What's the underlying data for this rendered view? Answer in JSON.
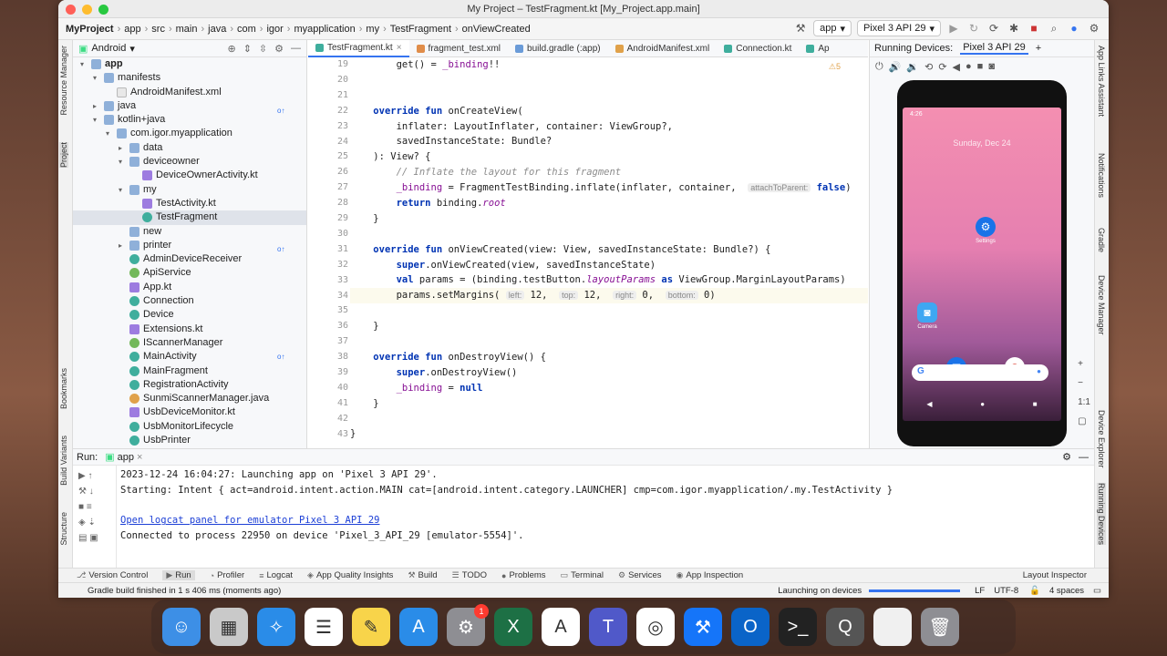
{
  "window": {
    "title": "My Project – TestFragment.kt [My_Project.app.main]"
  },
  "breadcrumb": [
    "MyProject",
    "app",
    "src",
    "main",
    "java",
    "com",
    "igor",
    "myapplication",
    "my",
    "TestFragment",
    "onViewCreated"
  ],
  "toolbar": {
    "run_config": "app",
    "device": "Pixel 3 API 29"
  },
  "left_stripe": [
    "Resource Manager",
    "Project",
    "Bookmarks",
    "Build Variants",
    "Structure"
  ],
  "right_stripe": [
    "App Links Assistant",
    "Notifications",
    "Gradle",
    "Device Manager",
    "Device Explorer",
    "Running Devices"
  ],
  "project": {
    "view": "Android",
    "tree": [
      {
        "label": "app",
        "indent": 0,
        "arrow": "▾",
        "icon": "folder",
        "bold": true
      },
      {
        "label": "manifests",
        "indent": 1,
        "arrow": "▾",
        "icon": "folder"
      },
      {
        "label": "AndroidManifest.xml",
        "indent": 2,
        "arrow": "",
        "icon": "file"
      },
      {
        "label": "java",
        "indent": 1,
        "arrow": "▸",
        "icon": "folder"
      },
      {
        "label": "kotlin+java",
        "indent": 1,
        "arrow": "▾",
        "icon": "folder"
      },
      {
        "label": "com.igor.myapplication",
        "indent": 2,
        "arrow": "▾",
        "icon": "folder"
      },
      {
        "label": "data",
        "indent": 3,
        "arrow": "▸",
        "icon": "folder"
      },
      {
        "label": "deviceowner",
        "indent": 3,
        "arrow": "▾",
        "icon": "folder"
      },
      {
        "label": "DeviceOwnerActivity.kt",
        "indent": 4,
        "arrow": "",
        "icon": "kt"
      },
      {
        "label": "my",
        "indent": 3,
        "arrow": "▾",
        "icon": "folder"
      },
      {
        "label": "TestActivity.kt",
        "indent": 4,
        "arrow": "",
        "icon": "kt"
      },
      {
        "label": "TestFragment",
        "indent": 4,
        "arrow": "",
        "icon": "cls",
        "selected": true
      },
      {
        "label": "new",
        "indent": 3,
        "arrow": "",
        "icon": "folder"
      },
      {
        "label": "printer",
        "indent": 3,
        "arrow": "▸",
        "icon": "folder"
      },
      {
        "label": "AdminDeviceReceiver",
        "indent": 3,
        "arrow": "",
        "icon": "cls"
      },
      {
        "label": "ApiService",
        "indent": 3,
        "arrow": "",
        "icon": "iface"
      },
      {
        "label": "App.kt",
        "indent": 3,
        "arrow": "",
        "icon": "kt"
      },
      {
        "label": "Connection",
        "indent": 3,
        "arrow": "",
        "icon": "cls"
      },
      {
        "label": "Device",
        "indent": 3,
        "arrow": "",
        "icon": "cls"
      },
      {
        "label": "Extensions.kt",
        "indent": 3,
        "arrow": "",
        "icon": "kt"
      },
      {
        "label": "IScannerManager",
        "indent": 3,
        "arrow": "",
        "icon": "iface"
      },
      {
        "label": "MainActivity",
        "indent": 3,
        "arrow": "",
        "icon": "cls"
      },
      {
        "label": "MainFragment",
        "indent": 3,
        "arrow": "",
        "icon": "cls"
      },
      {
        "label": "RegistrationActivity",
        "indent": 3,
        "arrow": "",
        "icon": "cls"
      },
      {
        "label": "SunmiScannerManager.java",
        "indent": 3,
        "arrow": "",
        "icon": "java"
      },
      {
        "label": "UsbDeviceMonitor.kt",
        "indent": 3,
        "arrow": "",
        "icon": "kt"
      },
      {
        "label": "UsbMonitorLifecycle",
        "indent": 3,
        "arrow": "",
        "icon": "cls"
      },
      {
        "label": "UsbPrinter",
        "indent": 3,
        "arrow": "",
        "icon": "cls"
      }
    ]
  },
  "editor": {
    "tabs": [
      {
        "label": "TestFragment.kt",
        "color": "#3fae9d",
        "active": true
      },
      {
        "label": "fragment_test.xml",
        "color": "#e08d4a"
      },
      {
        "label": "build.gradle (:app)",
        "color": "#6a9bd8"
      },
      {
        "label": "AndroidManifest.xml",
        "color": "#e0a14a"
      },
      {
        "label": "Connection.kt",
        "color": "#3fae9d"
      },
      {
        "label": "Ap",
        "color": "#3fae9d"
      }
    ],
    "warning": "⚠5",
    "lines": [
      {
        "n": "19",
        "html": "        get() = <span class='prop'>_binding</span>!!"
      },
      {
        "n": "20",
        "html": ""
      },
      {
        "n": "21",
        "html": ""
      },
      {
        "n": "22",
        "html": "    <span class='kw'>override fun</span> onCreateView(",
        "mark": "o"
      },
      {
        "n": "23",
        "html": "        inflater: LayoutInflater, container: ViewGroup?,"
      },
      {
        "n": "24",
        "html": "        savedInstanceState: Bundle?"
      },
      {
        "n": "25",
        "html": "    ): View? {"
      },
      {
        "n": "26",
        "html": "        <span class='cm'>// Inflate the layout for this fragment</span>"
      },
      {
        "n": "27",
        "html": "        <span class='prop'>_binding</span> = FragmentTestBinding.inflate(inflater, container,  <span class='hint'>attachToParent:</span> <span class='kw'>false</span>)"
      },
      {
        "n": "28",
        "html": "        <span class='kw'>return</span> binding.<span class='prop ital'>root</span>"
      },
      {
        "n": "29",
        "html": "    }"
      },
      {
        "n": "30",
        "html": ""
      },
      {
        "n": "31",
        "html": "    <span class='kw'>override fun</span> onViewCreated(view: View, savedInstanceState: Bundle?) {",
        "mark": "o"
      },
      {
        "n": "32",
        "html": "        <span class='kw'>super</span>.onViewCreated(view, savedInstanceState)"
      },
      {
        "n": "33",
        "html": "        <span class='kw'>val</span> params = (binding.testButton.<span class='prop ital'>layoutParams</span> <span class='kw'>as</span> ViewGroup.MarginLayoutParams)"
      },
      {
        "n": "34",
        "html": "        params.setMargins( <span class='hint'>left:</span> 12,  <span class='hint'>top:</span> 12,  <span class='hint'>right:</span> 0,  <span class='hint'>bottom:</span> 0)",
        "current": true
      },
      {
        "n": "35",
        "html": ""
      },
      {
        "n": "36",
        "html": "    }"
      },
      {
        "n": "37",
        "html": ""
      },
      {
        "n": "38",
        "html": "    <span class='kw'>override fun</span> onDestroyView() {",
        "mark": "o"
      },
      {
        "n": "39",
        "html": "        <span class='kw'>super</span>.onDestroyView()"
      },
      {
        "n": "40",
        "html": "        <span class='prop'>_binding</span> = <span class='kw'>null</span>"
      },
      {
        "n": "41",
        "html": "    }"
      },
      {
        "n": "42",
        "html": ""
      },
      {
        "n": "43",
        "html": "}"
      }
    ]
  },
  "devices": {
    "header": "Running Devices:",
    "tab": "Pixel 3 API 29",
    "date": "Sunday, Dec 24",
    "icon_labels": [
      "Settings",
      "Camera"
    ],
    "clock": "4:26"
  },
  "run": {
    "label": "Run:",
    "tab": "app",
    "output": [
      {
        "text": "2023-12-24 16:04:27: Launching app on 'Pixel 3 API 29'."
      },
      {
        "text": "Starting: Intent { act=android.intent.action.MAIN cat=[android.intent.category.LAUNCHER] cmp=com.igor.myapplication/.my.TestActivity }"
      },
      {
        "text": ""
      },
      {
        "text": "Open logcat panel for emulator Pixel 3 API 29",
        "link": true
      },
      {
        "text": "Connected to process 22950 on device 'Pixel_3_API_29 [emulator-5554]'."
      }
    ]
  },
  "bottom_tools": [
    {
      "label": "Version Control",
      "icon": "⎇"
    },
    {
      "label": "Run",
      "icon": "▶",
      "active": true
    },
    {
      "label": "Profiler",
      "icon": "◔"
    },
    {
      "label": "Logcat",
      "icon": "≡"
    },
    {
      "label": "App Quality Insights",
      "icon": "◈"
    },
    {
      "label": "Build",
      "icon": "⚒"
    },
    {
      "label": "TODO",
      "icon": "☰"
    },
    {
      "label": "Problems",
      "icon": "●"
    },
    {
      "label": "Terminal",
      "icon": "▭"
    },
    {
      "label": "Services",
      "icon": "⚙"
    },
    {
      "label": "App Inspection",
      "icon": "◉"
    }
  ],
  "layout_inspector": "Layout Inspector",
  "status": {
    "message": "Gradle build finished in 1 s 406 ms (moments ago)",
    "task": "Launching on devices",
    "progress": 1.0,
    "line_sep": "LF",
    "encoding": "UTF-8",
    "indent": "4 spaces"
  },
  "dock": [
    {
      "name": "finder",
      "color": "#3d8fe6",
      "glyph": "☺"
    },
    {
      "name": "launchpad",
      "color": "#c9c9c9",
      "glyph": "▦"
    },
    {
      "name": "safari",
      "color": "#2a8ce8",
      "glyph": "✧"
    },
    {
      "name": "reminders",
      "color": "#ffffff",
      "glyph": "☰"
    },
    {
      "name": "notes",
      "color": "#f8d44a",
      "glyph": "✎"
    },
    {
      "name": "app-store",
      "color": "#2a8ce8",
      "glyph": "A"
    },
    {
      "name": "system-settings",
      "color": "#8e8e93",
      "glyph": "⚙",
      "badge": "1"
    },
    {
      "name": "excel",
      "color": "#1d7045",
      "glyph": "X"
    },
    {
      "name": "instruments",
      "color": "#ffffff",
      "glyph": "A"
    },
    {
      "name": "teams",
      "color": "#5059c9",
      "glyph": "T"
    },
    {
      "name": "chrome",
      "color": "#ffffff",
      "glyph": "◎"
    },
    {
      "name": "xcode",
      "color": "#1575f9",
      "glyph": "⚒"
    },
    {
      "name": "outlook",
      "color": "#0a64c8",
      "glyph": "O"
    },
    {
      "name": "terminal",
      "color": "#222222",
      "glyph": ">_"
    },
    {
      "name": "quicktime",
      "color": "#555555",
      "glyph": "Q"
    },
    {
      "name": "document",
      "color": "#f0f0f0",
      "glyph": " "
    },
    {
      "name": "trash",
      "color": "#8e8e93",
      "glyph": "🗑"
    }
  ]
}
